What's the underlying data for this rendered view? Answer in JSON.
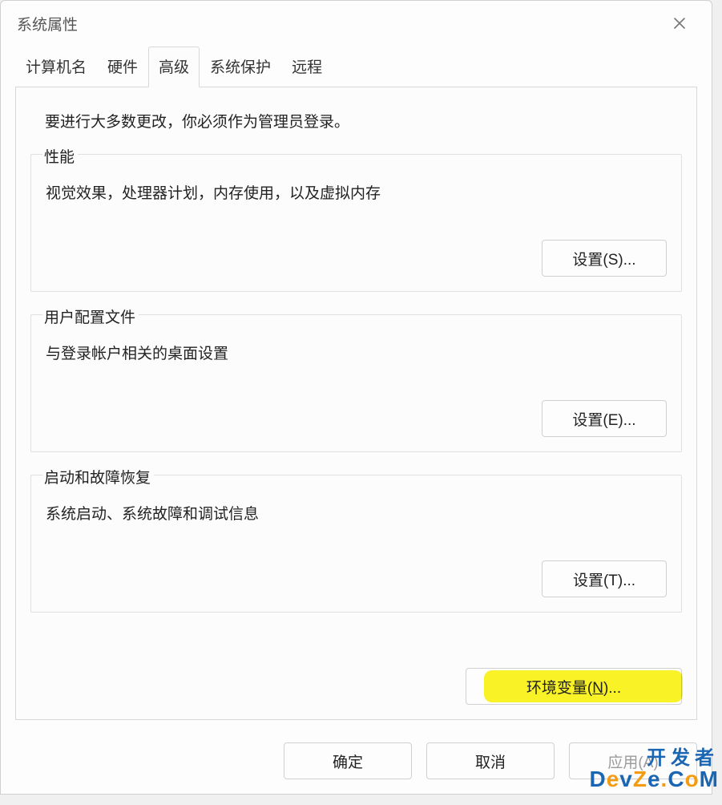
{
  "window": {
    "title": "系统属性"
  },
  "tabs": {
    "computer_name": "计算机名",
    "hardware": "硬件",
    "advanced": "高级",
    "system_protection": "系统保护",
    "remote": "远程"
  },
  "panel": {
    "admin_note": "要进行大多数更改，你必须作为管理员登录。",
    "performance": {
      "legend": "性能",
      "desc": "视觉效果，处理器计划，内存使用，以及虚拟内存",
      "button": "设置(S)..."
    },
    "userprofile": {
      "legend": "用户配置文件",
      "desc": "与登录帐户相关的桌面设置",
      "button": "设置(E)..."
    },
    "startup": {
      "legend": "启动和故障恢复",
      "desc": "系统启动、系统故障和调试信息",
      "button": "设置(T)..."
    },
    "env_button_prefix": "环境变量(",
    "env_button_key": "N",
    "env_button_suffix": ")..."
  },
  "footer": {
    "ok": "确定",
    "cancel": "取消",
    "apply": "应用(A)"
  },
  "watermark": {
    "line1": "开发者",
    "line2": "DevZe.CoM"
  }
}
